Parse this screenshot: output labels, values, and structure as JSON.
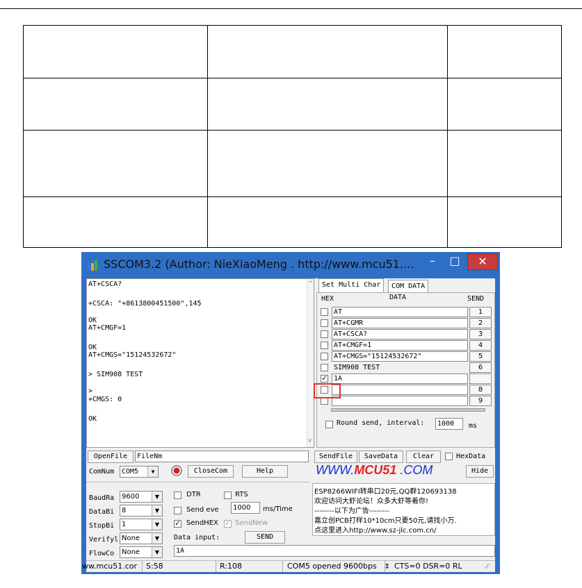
{
  "window": {
    "title": "SSCOM3.2 (Author: NieXiaoMeng . http://www.mcu51....",
    "controls": {
      "minimize": "–",
      "maximize": "□",
      "close": "✕"
    }
  },
  "receive_lines": [
    "AT+CSCA?",
    "+CSCA: \"+8613800451500\",145",
    "OK",
    "AT+CMGF=1",
    "OK",
    "AT+CMGS=\"15124532672\"",
    "> SIM908 TEST",
    ">",
    "+CMGS: 0",
    "OK"
  ],
  "scroll_arrows": {
    "up": "^",
    "down": "v"
  },
  "multi_panel": {
    "tab_active": "Set Multi Char",
    "tab_other": "COM DATA",
    "col_hex": "HEX",
    "col_data": "DATA",
    "col_send": "SEND",
    "rows": [
      {
        "checked": false,
        "data": "AT",
        "num": "1"
      },
      {
        "checked": false,
        "data": "AT+CGMR",
        "num": "2"
      },
      {
        "checked": false,
        "data": "AT+CSCA?",
        "num": "3"
      },
      {
        "checked": false,
        "data": "AT+CMGF=1",
        "num": "4"
      },
      {
        "checked": false,
        "data": "AT+CMGS=\"15124532672\"",
        "num": "5"
      },
      {
        "checked": false,
        "data": "SIM908 TEST",
        "num": "6"
      },
      {
        "checked": true,
        "data": "1A",
        "num": ""
      },
      {
        "checked": false,
        "data": "",
        "num": "8"
      },
      {
        "checked": false,
        "data": "",
        "num": "9"
      }
    ],
    "check_mark": "✓",
    "round_send_label": "Round send, interval:",
    "interval_value": "1000",
    "interval_unit": "ms"
  },
  "file_row": {
    "open_file": "OpenFile",
    "file_name": "FileNm",
    "send_file": "SendFile",
    "save_data": "SaveData",
    "clear": "Clear",
    "hex_data": "HexData"
  },
  "com_row": {
    "com_num_label": "ComNum",
    "com_value": "COM5",
    "close_com": "CloseCom",
    "help": "Help",
    "hide": "Hide"
  },
  "brand": {
    "prefix": "WWW.",
    "name": "MCU51",
    "suffix": " .COM"
  },
  "settings": {
    "baud_label": "BaudRa",
    "baud_value": "9600",
    "databits_label": "DataBi",
    "databits_value": "8",
    "stopbits_label": "StopBi",
    "stopbits_value": "1",
    "verify_label": "Verifyl",
    "verify_value": "None",
    "flow_label": "FlowCo",
    "flow_value": "None",
    "dtr": "DTR",
    "rts": "RTS",
    "send_every": "Send eve",
    "send_every_value": "1000",
    "ms_time": "ms/Time",
    "send_hex": "SendHEX",
    "send_new": "SendNew",
    "data_input": "Data input:",
    "send": "SEND",
    "input_value": "1A"
  },
  "ad_lines": [
    "ESP8266WIFI转串口20元,QQ群120693138",
    "欢迎访问大虾论坛！众多大虾等着你!",
    "--------以下为广告--------",
    "嘉立创PCB打样10*10cm只要50元,请找小万.",
    "点这里进入http://www.sz-jlc.com.cn/"
  ],
  "status_bar": {
    "url": "ww.mcu51.cor",
    "sent": "S:58",
    "received": "R:108",
    "port_state": "COM5 opened 9600bps",
    "separator": "‡",
    "signals": "CTS=0 DSR=0 RL"
  }
}
